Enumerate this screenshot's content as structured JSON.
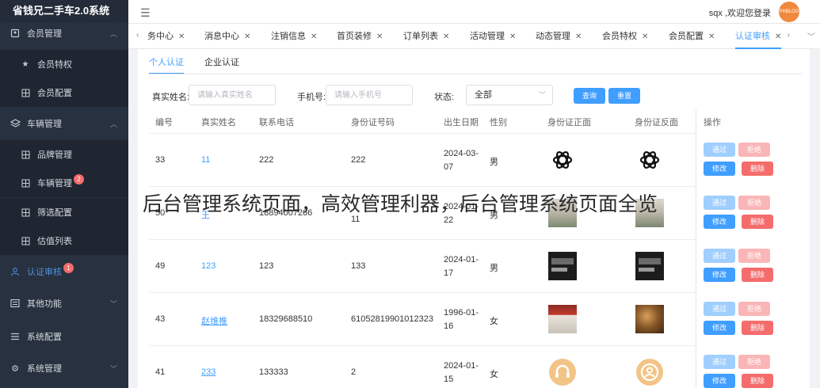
{
  "app": {
    "title": "省钱兄二手车2.0系统"
  },
  "sidebar": {
    "member_mgmt": "会员管理",
    "member_privilege": "会员特权",
    "member_config": "会员配置",
    "vehicle_mgmt": "车辆管理",
    "brand_mgmt": "品牌管理",
    "vehicle_list_mgmt": "车辆管理",
    "vehicle_badge": "2",
    "filter_config": "筛选配置",
    "valuation_list": "估值列表",
    "cert_review": "认证审核",
    "cert_badge": "1",
    "other_functions": "其他功能",
    "system_config": "系统配置",
    "system_mgmt": "系统管理"
  },
  "header": {
    "welcome": "sqx ,欢迎您登录",
    "avatar_text": "PHBLOG"
  },
  "tabs": [
    {
      "label": "务中心"
    },
    {
      "label": "消息中心"
    },
    {
      "label": "注销信息"
    },
    {
      "label": "首页装修"
    },
    {
      "label": "订单列表"
    },
    {
      "label": "活动管理"
    },
    {
      "label": "动态管理"
    },
    {
      "label": "会员特权"
    },
    {
      "label": "会员配置"
    },
    {
      "label": "认证审核"
    }
  ],
  "subtabs": {
    "personal": "个人认证",
    "company": "企业认证"
  },
  "filters": {
    "name_label": "真实姓名:",
    "name_placeholder": "请输入真实姓名",
    "phone_label": "手机号:",
    "phone_placeholder": "请输入手机号",
    "status_label": "状态:",
    "status_value": "全部",
    "query_btn": "查询",
    "reset_btn": "重置"
  },
  "table": {
    "headers": [
      "编号",
      "真实姓名",
      "联系电话",
      "身份证号码",
      "出生日期",
      "性别",
      "身份证正面",
      "身份证反面",
      "操作"
    ],
    "rows": [
      {
        "id": "33",
        "name": "11",
        "phone": "222",
        "idno": "222",
        "birth": "2024-03-07",
        "gender": "男",
        "front": "openai-logo",
        "back": "openai-logo"
      },
      {
        "id": "50",
        "name": "王",
        "phone": "18894007266",
        "idno": "11",
        "birth": "2024-01-22",
        "gender": "男",
        "front": "photo-thumb",
        "back": "photo-thumb"
      },
      {
        "id": "49",
        "name": "123",
        "phone": "123",
        "idno": "133",
        "birth": "2024-01-17",
        "gender": "男",
        "front": "screen-thumb",
        "back": "screen-thumb"
      },
      {
        "id": "43",
        "name": "赵维推",
        "phone": "18329688510",
        "idno": "61052819901012323",
        "birth": "1996-01-16",
        "gender": "女",
        "front": "shop-photo",
        "back": "food-photo"
      },
      {
        "id": "41",
        "name": "233",
        "phone": "133333",
        "idno": "2",
        "birth": "2024-01-15",
        "gender": "女",
        "front": "headset-icon",
        "back": "user-icon"
      }
    ],
    "ops": {
      "pass": "通过",
      "reject": "拒绝",
      "edit": "修改",
      "delete": "删除"
    }
  },
  "watermark": "后台管理系统页面，高效管理利器，后台管理系统页面全览"
}
